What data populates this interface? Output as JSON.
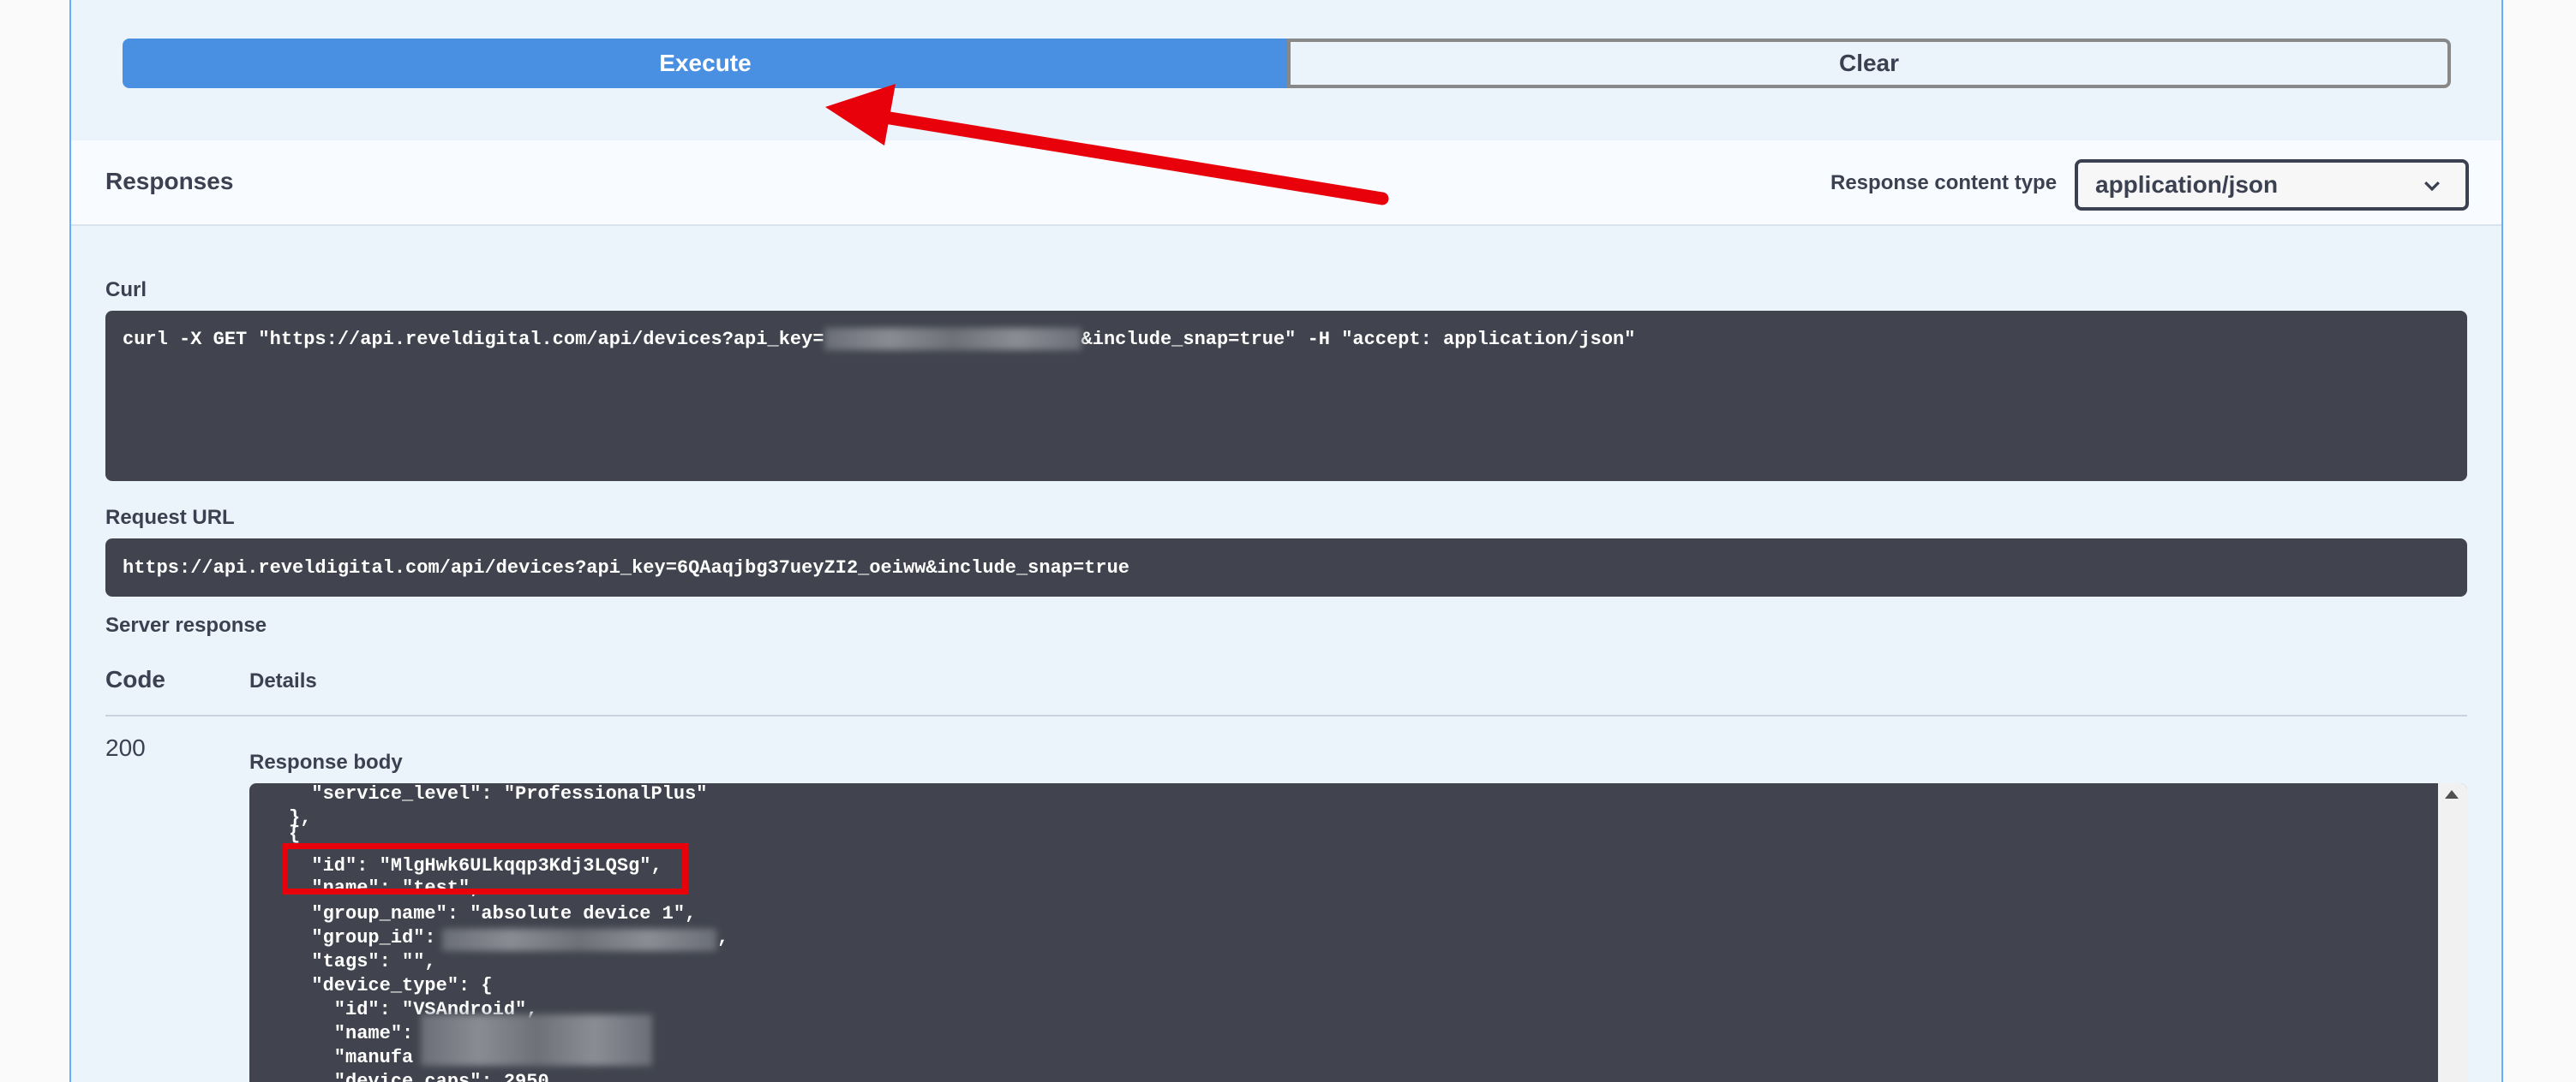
{
  "buttons": {
    "execute": "Execute",
    "clear": "Clear"
  },
  "responses": {
    "title": "Responses",
    "content_type_label": "Response content type",
    "content_type_value": "application/json"
  },
  "curl": {
    "label": "Curl",
    "prefix": "curl -X GET \"https://api.reveldigital.com/api/devices?api_key=",
    "suffix": "&include_snap=true\" -H \"accept: application/json\""
  },
  "request_url": {
    "label": "Request URL",
    "value": "https://api.reveldigital.com/api/devices?api_key=6QAaqjbg37ueyZI2_oeiww&include_snap=true"
  },
  "server_response": {
    "label": "Server response",
    "col_code": "Code",
    "col_details": "Details",
    "status_code": "200",
    "body_label": "Response body",
    "body_lines": [
      "  \"service_level\": \"ProfessionalPlus\"",
      "},",
      "{",
      "  \"id\": \"MlgHwk6ULkqqp3Kdj3LQSg\",",
      "  \"name\": \"test\",",
      "  \"group_name\": \"absolute device 1\",",
      "  \"group_id\":",
      "  \"tags\": \"\",",
      "  \"device_type\": {",
      "    \"id\": \"VSAndroid\",",
      "    \"name\":",
      "    \"manufa",
      "    \"device_caps\": 2950"
    ]
  },
  "colors": {
    "accent_blue": "#4990e2",
    "code_bg": "#41444e",
    "annotation_red": "#e8000b"
  }
}
